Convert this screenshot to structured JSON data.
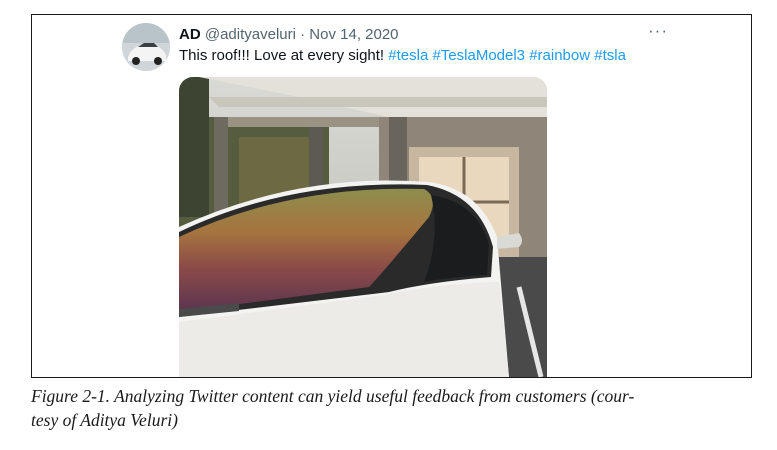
{
  "tweet": {
    "display_name": "AD",
    "handle": "@adityaveluri",
    "separator": "·",
    "date": "Nov 14, 2020",
    "more_label": "···",
    "text": "This roof!!! Love at every sight!",
    "hashtags": [
      "#tesla",
      "#TeslaModel3",
      "#rainbow",
      "#tsla"
    ]
  },
  "figure": {
    "caption_line1": "Figure 2-1. Analyzing Twitter content can yield useful feedback from customers (cour-",
    "caption_line2": "tesy of Aditya Veluri)"
  },
  "icons": {
    "more": "more-horizontal-icon"
  },
  "colors": {
    "hashtag": "#1d9bf0",
    "muted": "#536471",
    "text": "#0f1419"
  }
}
